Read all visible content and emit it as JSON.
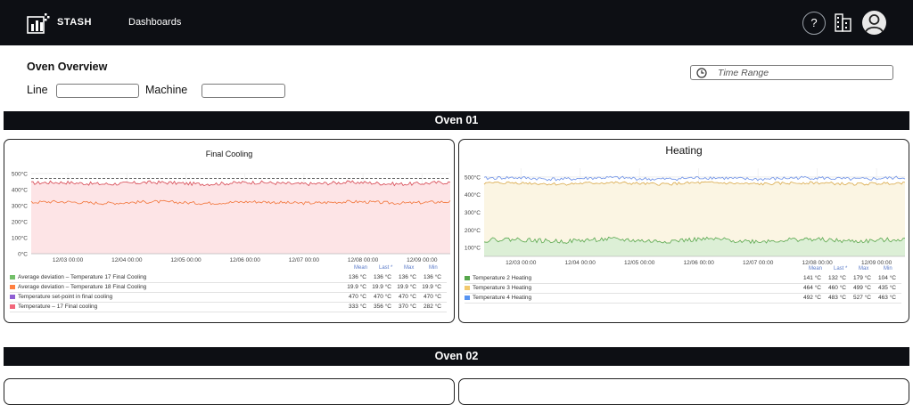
{
  "app": {
    "brand": "STASH",
    "nav": {
      "dashboards": "Dashboards"
    },
    "help_label": "?"
  },
  "page": {
    "title": "Oven Overview",
    "filters": {
      "line_label": "Line",
      "line_value": "",
      "machine_label": "Machine",
      "machine_value": ""
    },
    "time_range_placeholder": "Time Range"
  },
  "sections": [
    {
      "title": "Oven 01"
    },
    {
      "title": "Oven 02"
    }
  ],
  "panels": {
    "final_cooling": {
      "title": "Final Cooling",
      "y_ticks": [
        "500°C",
        "400°C",
        "300°C",
        "200°C",
        "100°C",
        "0°C"
      ],
      "x_ticks": [
        "12/03 00:00",
        "12/04 00:00",
        "12/05 00:00",
        "12/06 00:00",
        "12/07 00:00",
        "12/08 00:00",
        "12/09 00:00"
      ],
      "legend_headers": [
        "Mean",
        "Last *",
        "Max",
        "Min"
      ],
      "legend": [
        {
          "name": "Average deviation – Temperature 17 Final Cooling",
          "color": "#73bf69",
          "mean": "136 °C",
          "last": "136 °C",
          "max": "136 °C",
          "min": "136 °C"
        },
        {
          "name": "Average deviation – Temperature 18 Final Cooling",
          "color": "#ff7f40",
          "mean": "19.9 °C",
          "last": "19.9 °C",
          "max": "19.9 °C",
          "min": "19.9 °C"
        },
        {
          "name": "Temperature set-point in final cooling",
          "color": "#8f5fd3",
          "mean": "470 °C",
          "last": "470 °C",
          "max": "470 °C",
          "min": "470 °C"
        },
        {
          "name": "Temperature – 17 Final cooling",
          "color": "#f2667a",
          "mean": "333 °C",
          "last": "356 °C",
          "max": "370 °C",
          "min": "282 °C"
        }
      ],
      "chart_data": {
        "type": "line",
        "title": "Final Cooling",
        "ylim": [
          0,
          500
        ],
        "y_unit": "°C",
        "x_range": [
          "12/02 12:00",
          "12/09 12:00"
        ],
        "grid": true,
        "series": [
          {
            "name": "Temperature – 17 Final cooling",
            "color": "#d64550",
            "mean": 440,
            "noise": 14,
            "fill": "#fde4e6"
          },
          {
            "name": "Average deviation – Temperature 18 Final Cooling",
            "color": "#f2753a",
            "mean": 320,
            "noise": 12
          },
          {
            "name": "Temperature set-point in final cooling",
            "color": "#333333",
            "value": 470,
            "dashed": true
          }
        ]
      }
    },
    "heating": {
      "title": "Heating",
      "y_ticks": [
        "500°C",
        "400°C",
        "300°C",
        "200°C",
        "100°C"
      ],
      "x_ticks": [
        "12/03 00:00",
        "12/04 00:00",
        "12/05 00:00",
        "12/06 00:00",
        "12/07 00:00",
        "12/08 00:00",
        "12/09 00:00"
      ],
      "legend_headers": [
        "Mean",
        "Last *",
        "Max",
        "Min"
      ],
      "legend": [
        {
          "name": "Temperature 2 Heating",
          "color": "#56a64b",
          "mean": "141 °C",
          "last": "132 °C",
          "max": "179 °C",
          "min": "104 °C"
        },
        {
          "name": "Temperature 3 Heating",
          "color": "#f2c96d",
          "mean": "464 °C",
          "last": "460 °C",
          "max": "499 °C",
          "min": "435 °C"
        },
        {
          "name": "Temperature 4 Heating",
          "color": "#5794f2",
          "mean": "492 °C",
          "last": "483 °C",
          "max": "527 °C",
          "min": "463 °C"
        }
      ],
      "chart_data": {
        "type": "line",
        "title": "Heating",
        "ylim": [
          50,
          550
        ],
        "y_unit": "°C",
        "x_range": [
          "12/02 12:00",
          "12/09 12:00"
        ],
        "grid": true,
        "series": [
          {
            "name": "Temperature 4 Heating",
            "color": "#6b8fe6",
            "mean": 492,
            "noise": 12
          },
          {
            "name": "Temperature 3 Heating",
            "color": "#d9a94a",
            "mean": 464,
            "noise": 10,
            "fill": "#fbf5e3"
          },
          {
            "name": "Temperature 2 Heating",
            "color": "#56a64b",
            "mean": 141,
            "noise": 16,
            "fill": "#dcefd6"
          }
        ]
      }
    }
  }
}
